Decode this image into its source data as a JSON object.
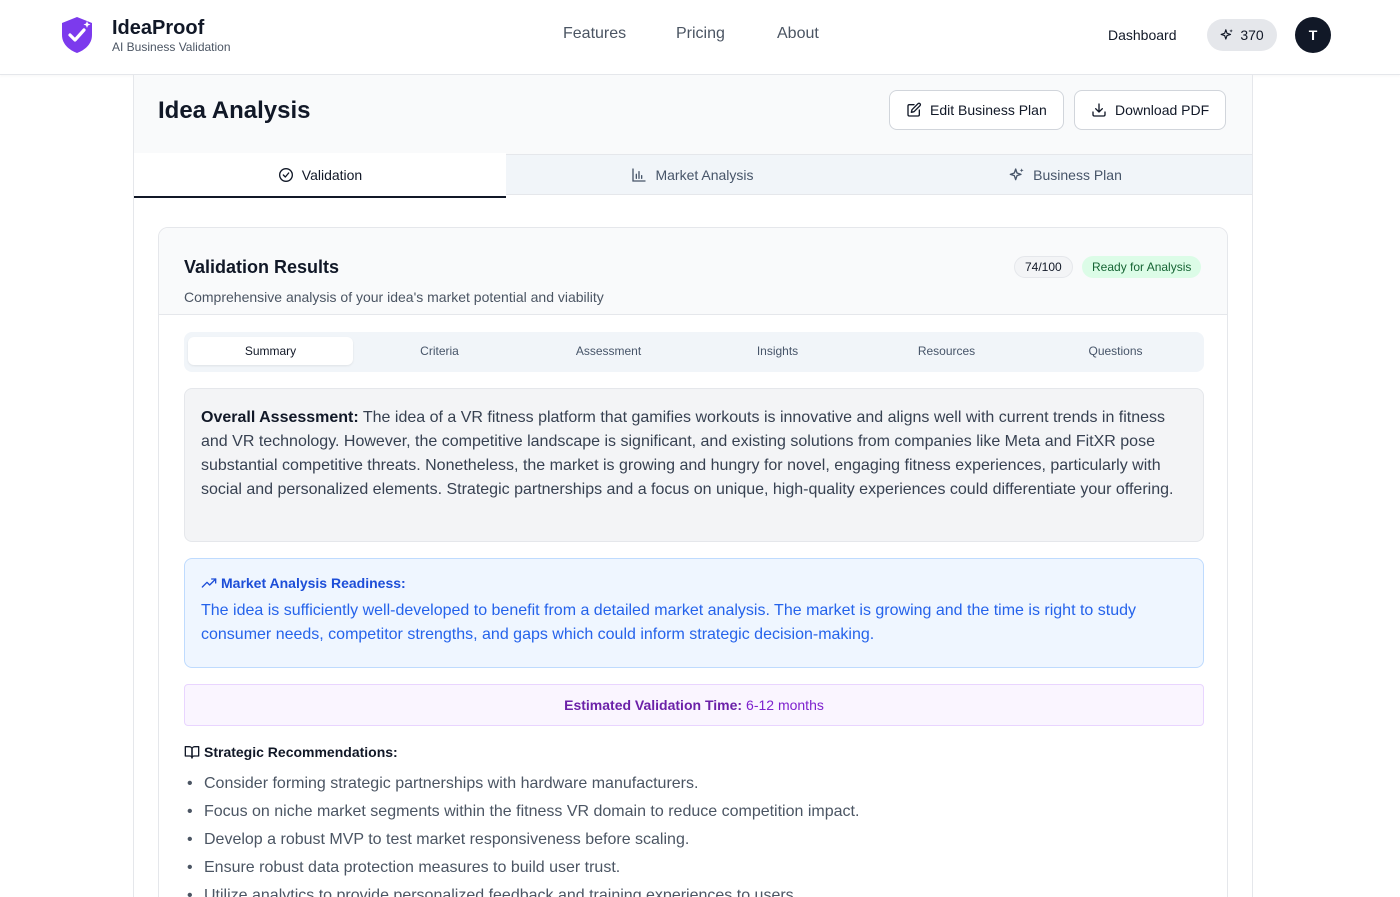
{
  "brand": {
    "name": "IdeaProof",
    "tagline": "AI Business Validation"
  },
  "nav": {
    "features": "Features",
    "pricing": "Pricing",
    "about": "About"
  },
  "user": {
    "dashboard": "Dashboard",
    "credits": "370",
    "avatar_initial": "T"
  },
  "page": {
    "title": "Idea Analysis",
    "edit_button": "Edit Business Plan",
    "download_button": "Download PDF"
  },
  "tabs": [
    {
      "label": "Validation",
      "icon": "check-circle-icon",
      "active": true
    },
    {
      "label": "Market Analysis",
      "icon": "bar-chart-icon",
      "active": false
    },
    {
      "label": "Business Plan",
      "icon": "sparkles-icon",
      "active": false
    }
  ],
  "validation": {
    "title": "Validation Results",
    "subtitle": "Comprehensive analysis of your idea's market potential and viability",
    "score": "74/100",
    "status": "Ready for Analysis",
    "subtabs": [
      "Summary",
      "Criteria",
      "Assessment",
      "Insights",
      "Resources",
      "Questions"
    ],
    "active_subtab": "Summary",
    "overall_label": "Overall Assessment:",
    "overall_text": "The idea of a VR fitness platform that gamifies workouts is innovative and aligns well with current trends in fitness and VR technology. However, the competitive landscape is significant, and existing solutions from companies like Meta and FitXR pose substantial competitive threats. Nonetheless, the market is growing and hungry for novel, engaging fitness experiences, particularly with social and personalized elements. Strategic partnerships and a focus on unique, high-quality experiences could differentiate your offering.",
    "readiness_title": "Market Analysis Readiness:",
    "readiness_text": "The idea is sufficiently well-developed to benefit from a detailed market analysis. The market is growing and the time is right to study consumer needs, competitor strengths, and gaps which could inform strategic decision-making.",
    "time_label": "Estimated Validation Time:",
    "time_value": "6-12 months",
    "rec_title": "Strategic Recommendations:",
    "recommendations": [
      "Consider forming strategic partnerships with hardware manufacturers.",
      "Focus on niche market segments within the fitness VR domain to reduce competition impact.",
      "Develop a robust MVP to test market responsiveness before scaling.",
      "Ensure robust data protection measures to build user trust.",
      "Utilize analytics to provide personalized feedback and training experiences to users."
    ]
  },
  "colors": {
    "accent_purple": "#7c3aed",
    "dark": "#111827",
    "success": "#166534",
    "info": "#2563eb"
  }
}
